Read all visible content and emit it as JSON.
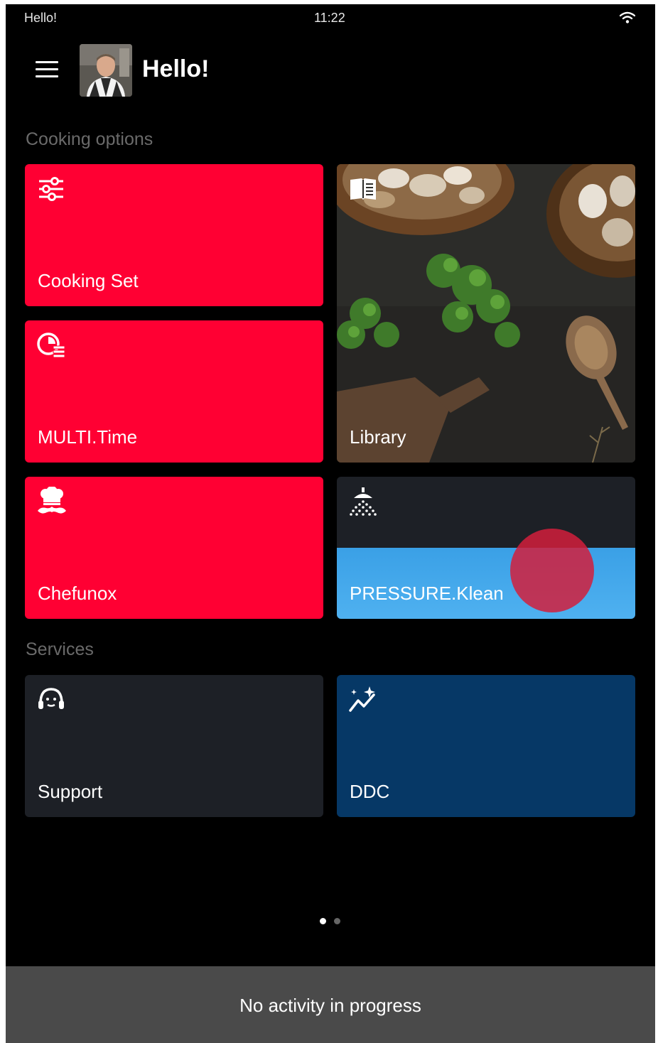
{
  "status_bar": {
    "left_text": "Hello!",
    "time": "11:22",
    "wifi_icon": "wifi-icon"
  },
  "header": {
    "menu_icon": "hamburger-menu-icon",
    "avatar": "chef-avatar",
    "title": "Hello!"
  },
  "cooking_options": {
    "section_label": "Cooking options",
    "tiles": [
      {
        "label": "Cooking Set",
        "icon": "sliders-icon",
        "color": "#ff0033"
      },
      {
        "label": "MULTI.Time",
        "icon": "multi-timer-icon",
        "color": "#ff0033"
      },
      {
        "label": "Chefunox",
        "icon": "chef-hat-mustache-icon",
        "color": "#ff0033"
      },
      {
        "label": "Library",
        "icon": "recipe-book-icon"
      },
      {
        "label": "PRESSURE.Klean",
        "icon": "shower-spray-icon",
        "color": "#3aa0e6"
      }
    ]
  },
  "services": {
    "section_label": "Services",
    "tiles": [
      {
        "label": "Support",
        "icon": "support-headset-icon",
        "color": "#1d2026"
      },
      {
        "label": "DDC",
        "icon": "analytics-sparkle-icon",
        "color": "#063866"
      }
    ]
  },
  "pagination": {
    "current_page": 1,
    "total_pages": 2
  },
  "activity_bar": {
    "text": "No activity in progress"
  }
}
